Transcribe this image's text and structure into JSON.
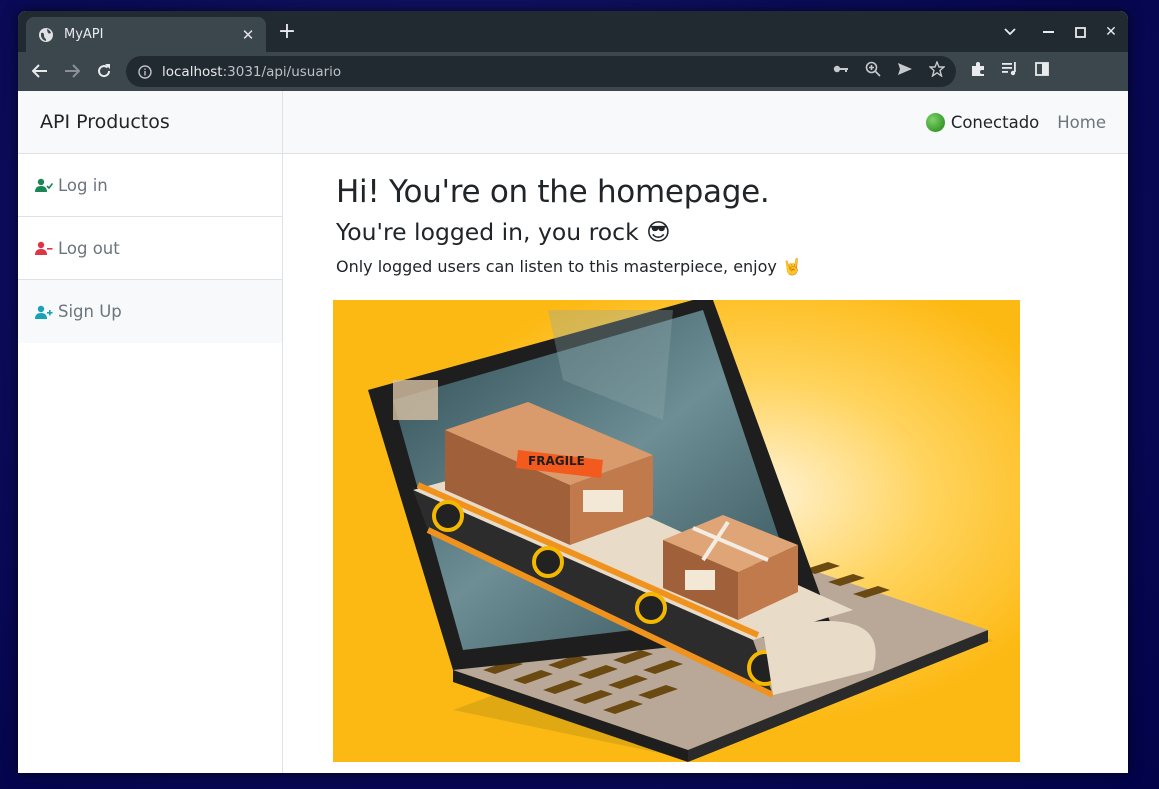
{
  "browser": {
    "tab_title": "MyAPI",
    "url_host": "localhost",
    "url_rest": ":3031/api/usuario"
  },
  "sidebar": {
    "brand": "API Productos",
    "items": [
      {
        "label": "Log in",
        "icon": "user-check-icon",
        "color": "#198754"
      },
      {
        "label": "Log out",
        "icon": "user-minus-icon",
        "color": "#dc3545"
      },
      {
        "label": "Sign Up",
        "icon": "user-plus-icon",
        "color": "#0dcaf0"
      }
    ]
  },
  "topnav": {
    "status": "Conectado",
    "home": "Home"
  },
  "main": {
    "heading": "Hi! You're on the homepage.",
    "subheading": "You're logged in, you rock 😎",
    "text": "Only logged users can listen to this masterpiece, enjoy 🤘"
  },
  "hero": {
    "label": "FRAGILE",
    "colors": {
      "background": "#fdb913",
      "laptop": "#1e1e1e",
      "box": "#c98a5a"
    }
  }
}
